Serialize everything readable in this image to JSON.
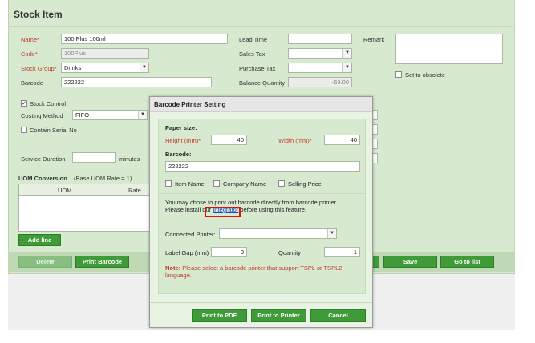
{
  "page": {
    "title": "Stock Item"
  },
  "form": {
    "name_label": "Name*",
    "name_value": "100 Plus 100ml",
    "code_label": "Code*",
    "code_value": "100Plus",
    "stock_group_label": "Stock Group*",
    "stock_group_value": "Drinks",
    "barcode_label": "Barcode",
    "barcode_value": "222222",
    "lead_time_label": "Lead Time",
    "lead_time_value": "",
    "sales_tax_label": "Sales Tax",
    "sales_tax_value": "",
    "purchase_tax_label": "Purchase Tax",
    "purchase_tax_value": "",
    "balance_qty_label": "Balance Quantity",
    "balance_qty_value": "-59.00",
    "remark_label": "Remark",
    "remark_value": "",
    "set_obsolete_label": "Set to obsolete",
    "stock_control_label": "Stock Control",
    "stock_control_checked": true,
    "costing_method_label": "Costing Method",
    "costing_method_value": "FIFO",
    "contain_serial_label": "Contain Serial No",
    "service_duration_label": "Service Duration",
    "service_duration_value": "",
    "service_duration_unit": "minutes"
  },
  "uom": {
    "title": "UOM Conversion",
    "subtitle": "(Base UOM Rate = 1)",
    "columns": [
      "UOM",
      "Rate"
    ],
    "add_line_label": "Add line"
  },
  "bottom_bar": {
    "delete_label": "Delete",
    "print_barcode_label": "Print Barcode",
    "save_label": "Save",
    "go_to_list_label": "Go to list"
  },
  "modal": {
    "title": "Barcode Printer Setting",
    "paper_size_label": "Paper size:",
    "height_label": "Height (mm)*",
    "height_value": "40",
    "width_label": "Width (mm)*",
    "width_value": "40",
    "barcode_label": "Barcode:",
    "barcode_value": "222222",
    "item_name_label": "Item Name",
    "company_name_label": "Company Name",
    "selling_price_label": "Selling Price",
    "info_line1": "You may chose to print out barcode directly from barcode printer.",
    "info_line2_pre": "Please install our",
    "info_link": "Integrator",
    "info_line2_post": "before using this feature.",
    "connected_printer_label": "Connected Printer:",
    "connected_printer_value": "",
    "label_gap_label": "Label Gap (mm)",
    "label_gap_value": "3",
    "quantity_label": "Quantity",
    "quantity_value": "1",
    "note_label": "Note:",
    "note_text": "Please select a barcode printer that support TSPL or TSPL2 language.",
    "print_pdf_label": "Print to PDF",
    "print_printer_label": "Print to Printer",
    "cancel_label": "Cancel"
  },
  "colors": {
    "panel_bg": "#d7ead0",
    "button_green": "#3f9a38",
    "required_red": "#c0392b",
    "link_blue": "#1a47c9",
    "highlight_red": "#e01010"
  }
}
